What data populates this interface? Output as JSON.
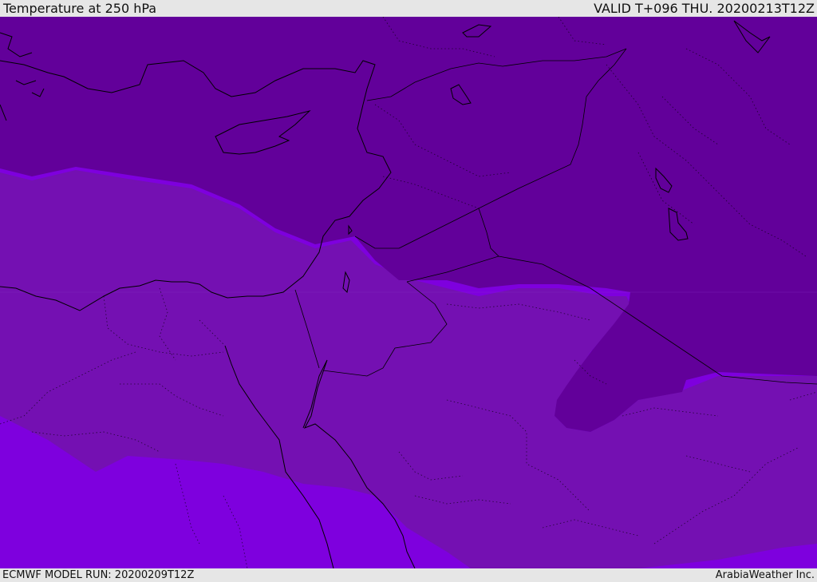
{
  "header": {
    "title": "Temperature at 250 hPa",
    "valid": "VALID T+096 THU. 20200213T12Z"
  },
  "footer": {
    "model_run": "ECMWF MODEL RUN: 20200209T12Z",
    "credit": "ArabiaWeather Inc."
  },
  "map": {
    "parameter": "temperature",
    "pressure_level_hpa": 250,
    "bands": [
      {
        "name": "cold",
        "color": "#62009a"
      },
      {
        "name": "mid",
        "color": "#7410b2"
      },
      {
        "name": "warm",
        "color": "#7e00de"
      }
    ],
    "border_color": "#000000"
  }
}
